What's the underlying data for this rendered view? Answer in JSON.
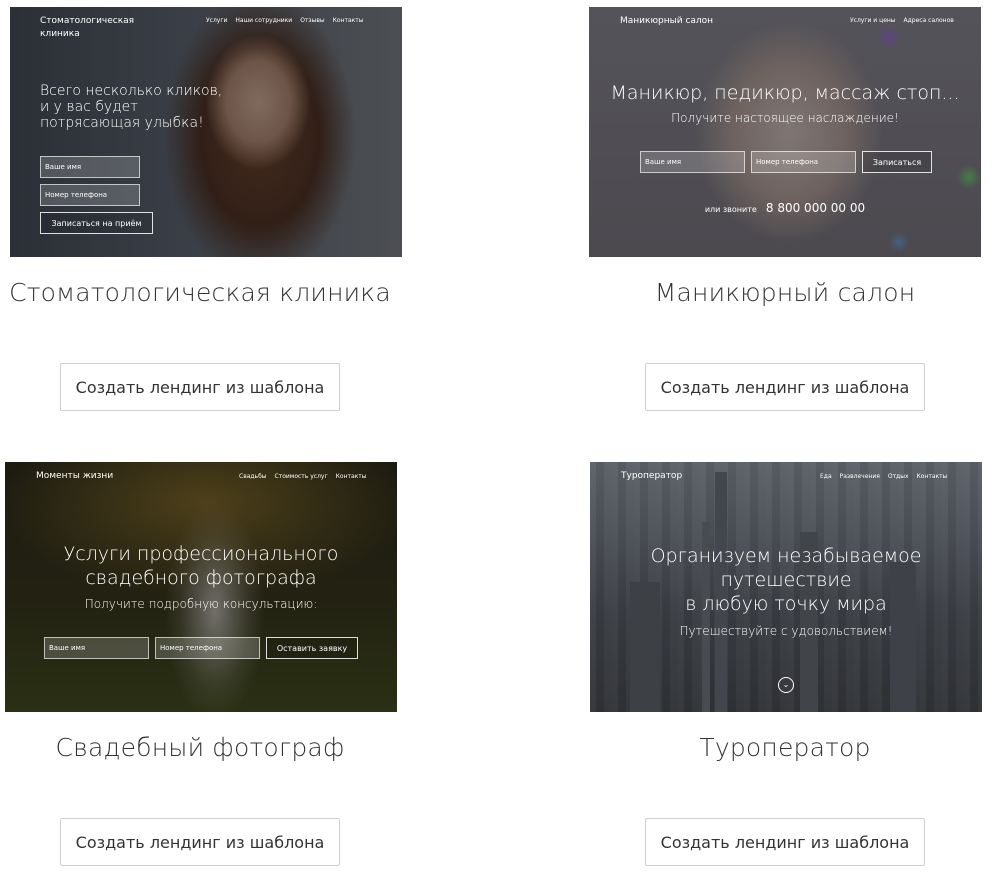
{
  "cards": [
    {
      "title": "Стоматологическая клиника",
      "button_label": "Создать лендинг из шаблона",
      "thumb": {
        "brand": "Стоматологическая\nклиника",
        "nav": [
          "Услуги",
          "Наши сотрудники",
          "Отзывы",
          "Контакты"
        ],
        "headline": "Всего несколько кликов,\nи у вас будет\nпотрясающая улыбка!",
        "field_name": "Ваше имя",
        "field_phone": "Номер телефона",
        "cta": "Записаться на приём"
      }
    },
    {
      "title": "Маникюрный салон",
      "button_label": "Создать лендинг из шаблона",
      "thumb": {
        "brand": "Маникюрный салон",
        "nav": [
          "Услуги и цены",
          "Адреса салонов"
        ],
        "headline": "Маникюр, педикюр, массаж стоп...",
        "subheadline": "Получите настоящее наслаждение!",
        "field_name": "Ваше имя",
        "field_phone": "Номер телефона",
        "cta": "Записаться",
        "call_label": "или звоните",
        "phone": "8 800 000 00 00"
      }
    },
    {
      "title": "Свадебный фотограф",
      "button_label": "Создать лендинг из шаблона",
      "thumb": {
        "brand": "Моменты жизни",
        "nav": [
          "Свадьбы",
          "Стоимость услуг",
          "Контакты"
        ],
        "headline": "Услуги профессионального\nсвадебного фотографа",
        "subheadline": "Получите подробную консультацию:",
        "field_name": "Ваше имя",
        "field_phone": "Номер телефона",
        "cta": "Оставить заявку"
      }
    },
    {
      "title": "Туроператор",
      "button_label": "Создать лендинг из шаблона",
      "thumb": {
        "brand": "Туроператор",
        "nav": [
          "Еда",
          "Развлечения",
          "Отдых",
          "Контакты"
        ],
        "headline": "Организуем незабываемое\nпутешествие\nв любую точку мира",
        "subheadline": "Путешествуйте с удовольствием!"
      }
    }
  ],
  "icons": {
    "scroll_down": "chevron-down-circle-icon",
    "scroll_glyph": "⌄"
  },
  "colors": {
    "text": "#333333",
    "button_border": "#cfcfcf",
    "background": "#ffffff"
  }
}
